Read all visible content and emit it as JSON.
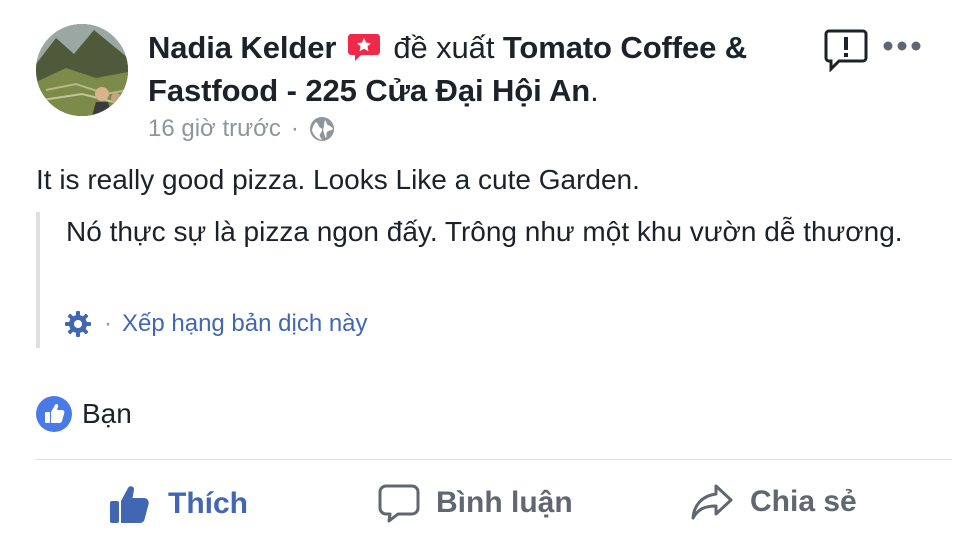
{
  "post": {
    "author": "Nadia Kelder",
    "verb": "đề xuất",
    "place": "Tomato Coffee & Fastfood - 225 Cửa Đại Hội An",
    "place_suffix": ".",
    "time": "16 giờ trước",
    "separator": "·",
    "text": "It is really good pizza. Looks Like a cute Garden.",
    "translation": "Nó thực sự là pizza ngon đấy. Trông như một khu vườn dễ thương.",
    "rate_translation": "Xếp hạng bản dịch này"
  },
  "reactions": {
    "label": "Bạn"
  },
  "actions": {
    "like": "Thích",
    "comment": "Bình luận",
    "share": "Chia sẻ"
  },
  "colors": {
    "link_blue": "#4267b2",
    "recommend_red": "#f02849",
    "meta_gray": "#90949c",
    "action_gray": "#606770"
  },
  "icons": {
    "recommend": "recommend-icon",
    "report": "report-icon",
    "more": "more-icon",
    "globe": "globe-icon",
    "gear": "gear-icon",
    "like_badge": "like-badge-icon",
    "like": "thumbs-up-icon",
    "comment": "comment-icon",
    "share": "share-icon"
  }
}
